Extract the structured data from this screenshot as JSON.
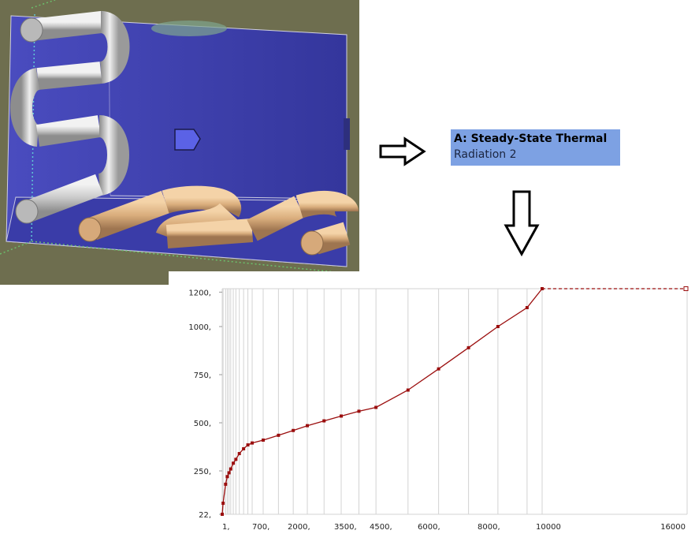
{
  "outline": {
    "title": "A: Steady-State Thermal",
    "subtitle": "Radiation 2"
  },
  "viewport": {
    "background_color": "#6e6e4f",
    "face_color": "#3d3fa8",
    "selection_marker_color": "#5b62e6"
  },
  "chart_data": {
    "type": "line",
    "series": [
      {
        "color": "#9b0e0e",
        "x": [
          1,
          22,
          80,
          120,
          160,
          200,
          260,
          320,
          400,
          500,
          600,
          700,
          1200,
          1700,
          2200,
          2700,
          3200,
          3700,
          4200,
          4700,
          5700,
          6700,
          7700,
          8700,
          9700,
          10700
        ],
        "y": [
          22,
          80,
          180,
          220,
          240,
          260,
          290,
          310,
          340,
          365,
          385,
          395,
          410,
          435,
          460,
          485,
          510,
          535,
          560,
          580,
          670,
          780,
          890,
          1000,
          1110,
          1220
        ]
      }
    ],
    "extrapolation": {
      "x": [
        10700,
        16000
      ],
      "y": [
        1220,
        1220
      ],
      "style": "dashed"
    },
    "x_ticks": [
      {
        "value": 1,
        "label": "1,"
      },
      {
        "value": 700,
        "label": "700,"
      },
      {
        "value": 2000,
        "label": "2000,"
      },
      {
        "value": 3500,
        "label": "3500,"
      },
      {
        "value": 4500,
        "label": "4500,"
      },
      {
        "value": 6000,
        "label": "6000,"
      },
      {
        "value": 8000,
        "label": "8000,"
      },
      {
        "value": 10000,
        "label": "10000"
      },
      {
        "value": 16000,
        "label": "16000"
      }
    ],
    "y_ticks": [
      {
        "value": 22,
        "label": "22,"
      },
      {
        "value": 250,
        "label": "250,"
      },
      {
        "value": 500,
        "label": "500,"
      },
      {
        "value": 750,
        "label": "750,"
      },
      {
        "value": 1000,
        "label": "1000,"
      },
      {
        "value": 1200,
        "label": "1200,"
      }
    ],
    "x_gridlines": [
      1,
      22,
      80,
      120,
      160,
      200,
      260,
      320,
      400,
      500,
      600,
      700,
      1200,
      1700,
      2200,
      2700,
      3200,
      3700,
      4200,
      4700,
      5700,
      6700,
      7700,
      8700,
      9700,
      10700,
      16000
    ],
    "xlim": [
      1,
      16000
    ],
    "ylim": [
      22,
      1220
    ],
    "grid": true
  }
}
